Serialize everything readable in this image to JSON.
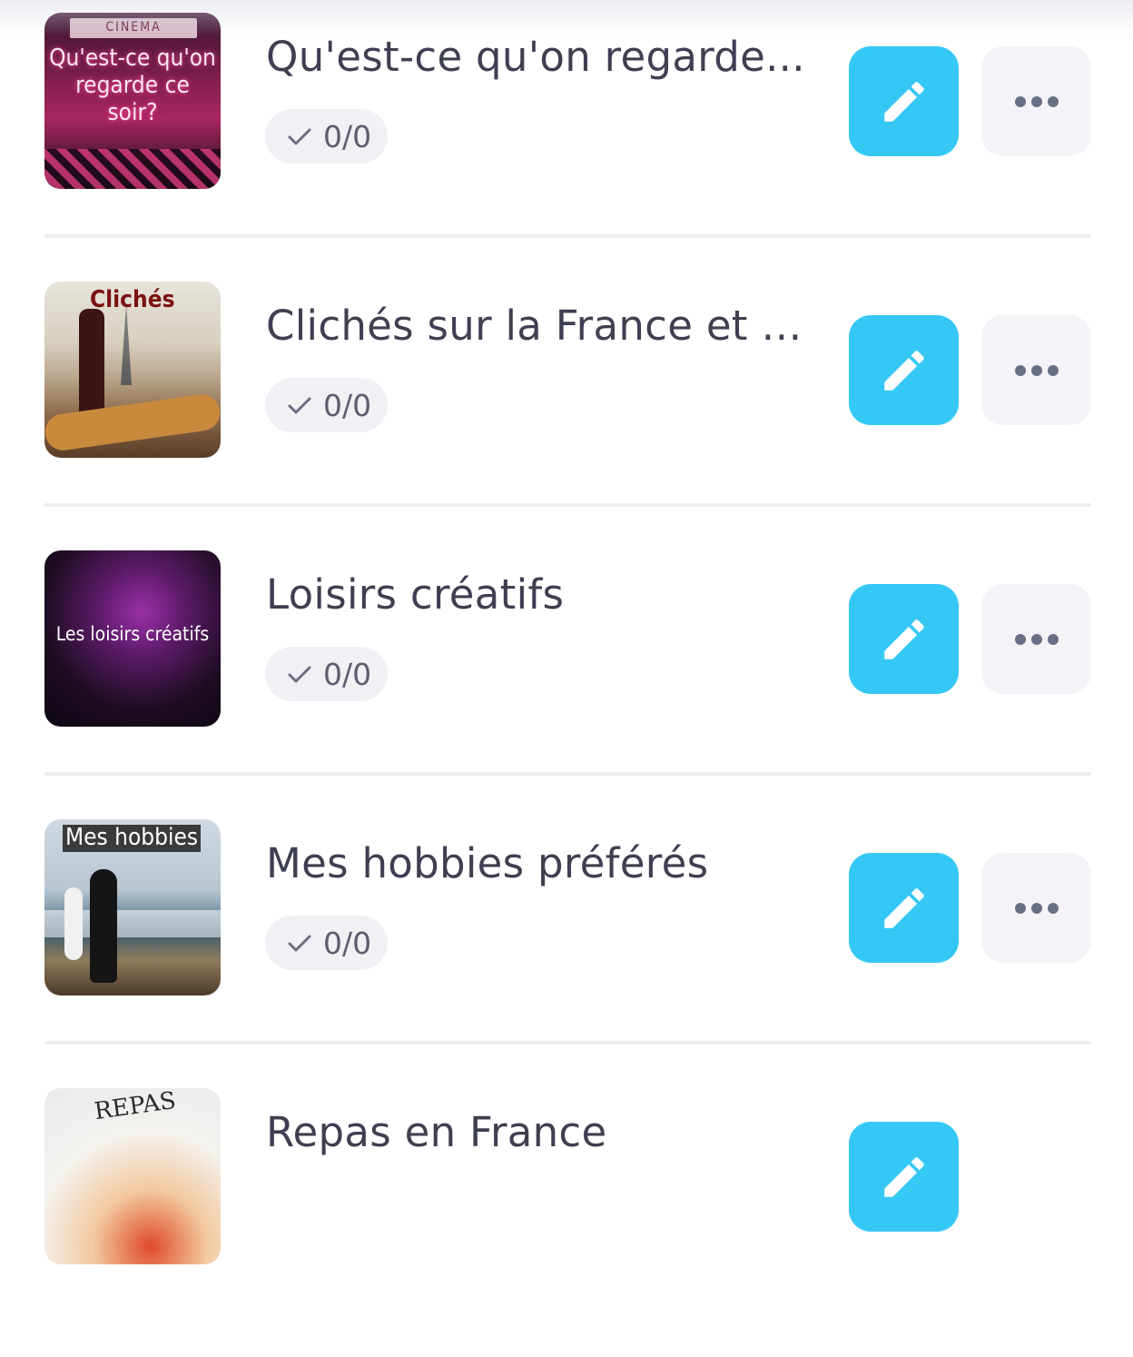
{
  "items": [
    {
      "title": "Qu'est-ce qu'on regarde...",
      "progress": "0/0",
      "thumb_caption": "Qu'est-ce qu'on regarde ce soir?",
      "thumb_sign": "CINEMA"
    },
    {
      "title": "Clichés sur la France et l...",
      "progress": "0/0",
      "thumb_caption": "Clichés"
    },
    {
      "title": "Loisirs créatifs",
      "progress": "0/0",
      "thumb_caption": "Les loisirs créatifs"
    },
    {
      "title": "Mes hobbies préférés",
      "progress": "0/0",
      "thumb_caption": "Mes hobbies"
    },
    {
      "title": "Repas en France",
      "progress": "",
      "thumb_caption": "REPAS"
    }
  ],
  "colors": {
    "edit_button": "#36c8f5",
    "more_button": "#f4f4f8",
    "title_text": "#3f3f52",
    "badge_bg": "#f1f1f5"
  },
  "icons": {
    "edit": "pencil-icon",
    "more": "more-dots-icon",
    "progress": "check-icon"
  }
}
